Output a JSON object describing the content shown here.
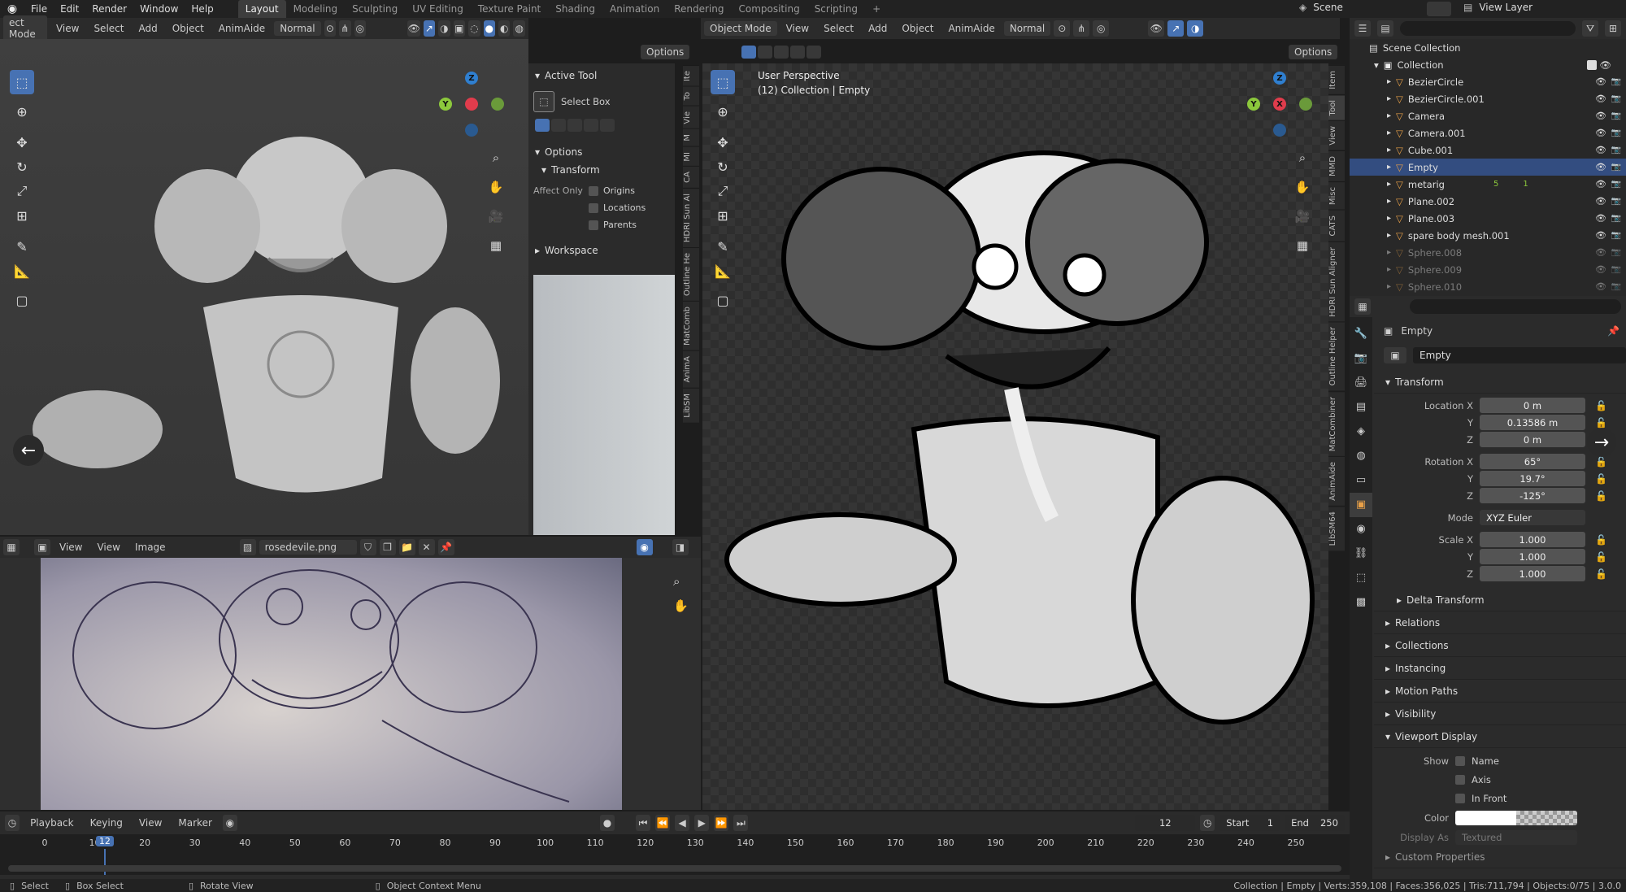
{
  "topbar": {
    "mode": "ect Mode",
    "menus": [
      "File",
      "Edit",
      "Render",
      "Window",
      "Help"
    ],
    "workspaces": [
      "Layout",
      "Modeling",
      "Sculpting",
      "UV Editing",
      "Texture Paint",
      "Shading",
      "Animation",
      "Rendering",
      "Compositing",
      "Scripting"
    ],
    "plus": "+",
    "scene": "Scene",
    "view_layer": "View Layer"
  },
  "left_view": {
    "menus": [
      "View",
      "Select",
      "Add",
      "Object",
      "AnimAide"
    ],
    "orientation": "Normal",
    "options": "Options"
  },
  "npanel": {
    "active_tool": "Active Tool",
    "select_box": "Select Box",
    "options": "Options",
    "transform": "Transform",
    "affect_only": "Affect Only",
    "origins": "Origins",
    "locations": "Locations",
    "parents": "Parents",
    "workspace": "Workspace",
    "tabs": [
      "Ite",
      "To",
      "Vie",
      "M",
      "MI",
      "CA",
      "HDRI Sun Al",
      "Outline He",
      "MatComb",
      "AnimA",
      "LibSM"
    ]
  },
  "image_editor": {
    "view": "View",
    "view2": "View",
    "image": "Image",
    "filename": "rosedevile.png"
  },
  "right_view": {
    "mode": "Object Mode",
    "menus": [
      "View",
      "Select",
      "Add",
      "Object",
      "AnimAide"
    ],
    "orientation": "Normal",
    "options": "Options",
    "perspective": "User Perspective",
    "collection_info": "(12) Collection | Empty",
    "tabs": [
      "Item",
      "Tool",
      "View",
      "MMD",
      "Misc",
      "CATS",
      "HDRI Sun Aligner",
      "Outline Helper",
      "MatCombiner",
      "AnimAide",
      "LibSM64"
    ]
  },
  "outliner": {
    "scene_collection": "Scene Collection",
    "collection": "Collection",
    "items": [
      {
        "name": "BezierCircle",
        "color": "#e8a048"
      },
      {
        "name": "BezierCircle.001",
        "color": "#e8a048"
      },
      {
        "name": "Camera",
        "color": "#e8a048"
      },
      {
        "name": "Camera.001",
        "color": "#e8a048"
      },
      {
        "name": "Cube.001",
        "color": "#e8a048"
      },
      {
        "name": "Empty",
        "color": "#e8a048"
      },
      {
        "name": "metarig",
        "color": "#e8a048"
      },
      {
        "name": "Plane.002",
        "color": "#e8a048"
      },
      {
        "name": "Plane.003",
        "color": "#e8a048"
      },
      {
        "name": "spare body mesh.001",
        "color": "#e8a048"
      },
      {
        "name": "Sphere.008",
        "color": "#e8a048"
      },
      {
        "name": "Sphere.009",
        "color": "#e8a048"
      },
      {
        "name": "Sphere.010",
        "color": "#e8a048"
      }
    ],
    "metarig_badge1": "5",
    "metarig_badge2": "1"
  },
  "properties": {
    "object_name": "Empty",
    "data_name": "Empty",
    "transform": "Transform",
    "location": {
      "label_x": "Location X",
      "label_y": "Y",
      "label_z": "Z",
      "x": "0 m",
      "y": "0.13586 m",
      "z": "0 m"
    },
    "rotation": {
      "label_x": "Rotation X",
      "label_y": "Y",
      "label_z": "Z",
      "x": "65°",
      "y": "19.7°",
      "z": "-125°"
    },
    "mode_label": "Mode",
    "mode_value": "XYZ Euler",
    "scale": {
      "label_x": "Scale X",
      "label_y": "Y",
      "label_z": "Z",
      "x": "1.000",
      "y": "1.000",
      "z": "1.000"
    },
    "delta_transform": "Delta Transform",
    "sections": [
      "Relations",
      "Collections",
      "Instancing",
      "Motion Paths",
      "Visibility"
    ],
    "viewport_display": "Viewport Display",
    "show": "Show",
    "name": "Name",
    "axis": "Axis",
    "in_front": "In Front",
    "color": "Color",
    "display_as": "Display As",
    "display_as_value": "Textured",
    "custom_props": "Custom Properties"
  },
  "timeline": {
    "playback": "Playback",
    "keying": "Keying",
    "view": "View",
    "marker": "Marker",
    "current_frame": "12",
    "start_label": "Start",
    "start": "1",
    "end_label": "End",
    "end": "250",
    "playhead": "12",
    "ticks": [
      "0",
      "10",
      "20",
      "30",
      "40",
      "50",
      "60",
      "70",
      "80",
      "90",
      "100",
      "110",
      "120",
      "130",
      "140",
      "150",
      "160",
      "170",
      "180",
      "190",
      "200",
      "210",
      "220",
      "230",
      "240",
      "250"
    ]
  },
  "status": {
    "select": "Select",
    "box_select": "Box Select",
    "rotate_view": "Rotate View",
    "context_menu": "Object Context Menu",
    "stats": "Collection | Empty | Verts:359,108 | Faces:356,025 | Tris:711,794 | Objects:0/75 | 3.0.0"
  }
}
